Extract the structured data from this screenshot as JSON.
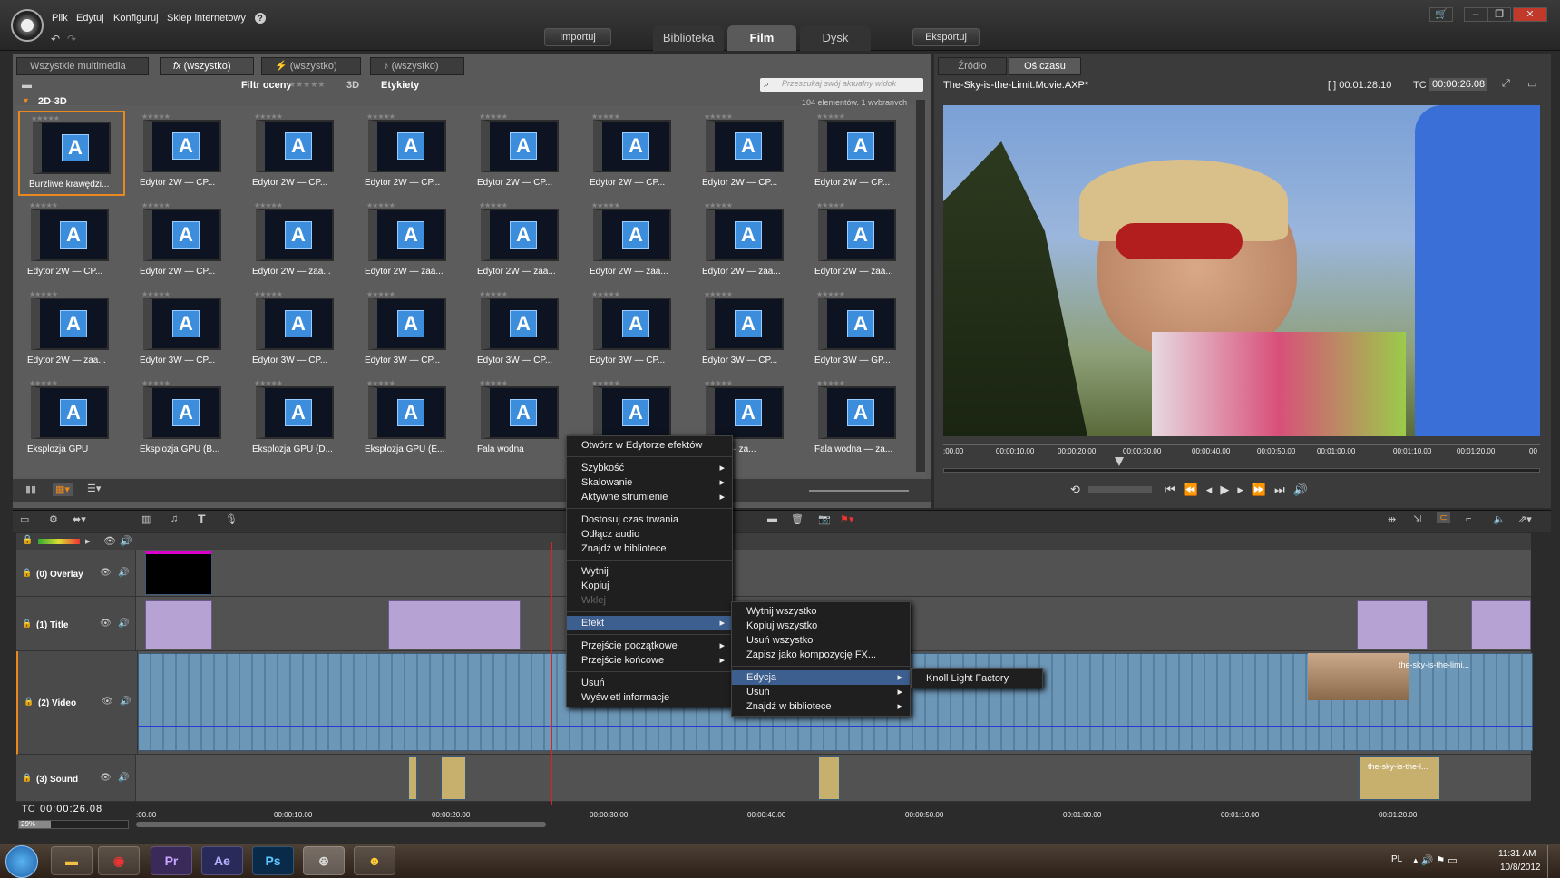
{
  "menu": {
    "file": "Plik",
    "edit": "Edytuj",
    "config": "Konfiguruj",
    "store": "Sklep internetowy",
    "help": "?"
  },
  "top": {
    "import": "Importuj",
    "export": "Eksportuj",
    "tabs": [
      "Biblioteka",
      "Film",
      "Dysk"
    ]
  },
  "library": {
    "tabs": [
      "Wszystkie multimedia",
      "(wszystko)",
      "(wszystko)",
      "(wszystko)"
    ],
    "rating_filter": "Filtr oceny",
    "rating_stars": "★★★★★",
    "three_d": "3D",
    "tags": "Etykiety",
    "search_placeholder": "Przeszukaj swój aktualny widok",
    "folder": "2D-3D",
    "count": "104 elementów, 1 wybranych",
    "items": [
      "Burzliwe krawędzi...",
      "Edytor 2W — CP...",
      "Edytor 2W — CP...",
      "Edytor 2W — CP...",
      "Edytor 2W — CP...",
      "Edytor 2W — CP...",
      "Edytor 2W — CP...",
      "Edytor 2W — CP...",
      "Edytor 2W — CP...",
      "Edytor 2W — CP...",
      "Edytor 2W — zaa...",
      "Edytor 2W — zaa...",
      "Edytor 2W — zaa...",
      "Edytor 2W — zaa...",
      "Edytor 2W — zaa...",
      "Edytor 2W — zaa...",
      "Edytor 2W — zaa...",
      "Edytor 3W — CP...",
      "Edytor 3W — CP...",
      "Edytor 3W — CP...",
      "Edytor 3W — CP...",
      "Edytor 3W — CP...",
      "Edytor 3W — CP...",
      "Edytor 3W — GP...",
      "Eksplozja GPU",
      "Eksplozja GPU (B...",
      "Eksplozja GPU (D...",
      "Eksplozja GPU (E...",
      "Fala wodna",
      "",
      "...dna — za...",
      "Fala wodna — za..."
    ]
  },
  "preview": {
    "tab_source": "Źródło",
    "tab_timeline": "Oś czasu",
    "filename": "The-Sky-is-the-Limit.Movie.AXP*",
    "duration": "[ ] 00:01:28.10",
    "tc_label": "TC",
    "tc": "00:00:26.08",
    "ruler": [
      ":00.00",
      "00:00:10.00",
      "00:00:20.00",
      "00:00:30.00",
      "00:00:40.00",
      "00:00:50.00",
      "00:01:00.00",
      "00:01:10.00",
      "00:01:20.00",
      "00"
    ]
  },
  "context_menu": {
    "items": [
      "Otwórz w Edytorze efektów",
      "Szybkość",
      "Skalowanie",
      "Aktywne strumienie",
      "Dostosuj czas trwania",
      "Odłącz audio",
      "Znajdź w bibliotece",
      "Wytnij",
      "Kopiuj",
      "Wklej",
      "Efekt",
      "Przejście początkowe",
      "Przejście końcowe",
      "Usuń",
      "Wyświetl informacje"
    ]
  },
  "submenu_effect": {
    "items": [
      "Wytnij wszystko",
      "Kopiuj wszystko",
      "Usuń wszystko",
      "Zapisz jako kompozycję FX...",
      "Edycja",
      "Usuń",
      "Znajdź w bibliotece"
    ]
  },
  "submenu_edit": {
    "item": "Knoll Light Factory"
  },
  "tracks": [
    "(0) Overlay",
    "(1) Title",
    "(2) Video",
    "(3) Sound"
  ],
  "timeline": {
    "tc_label": "TC",
    "tc": "00:00:26.08",
    "zoom": "29%",
    "ruler": [
      ":00.00",
      "00:00:10.00",
      "00:00:20.00",
      "00:00:30.00",
      "00:00:40.00",
      "00:00:50.00",
      "00:01:00.00",
      "00:01:10.00",
      "00:01:20.00"
    ],
    "clip_label_video": "the-sky-is-the-limi...",
    "clip_label_sound": "the-sky-is-the-l..."
  },
  "taskbar": {
    "icons": [
      "Pr",
      "Ae",
      "Ps"
    ],
    "lang": "PL",
    "time": "11:31 AM",
    "date": "10/8/2012"
  }
}
